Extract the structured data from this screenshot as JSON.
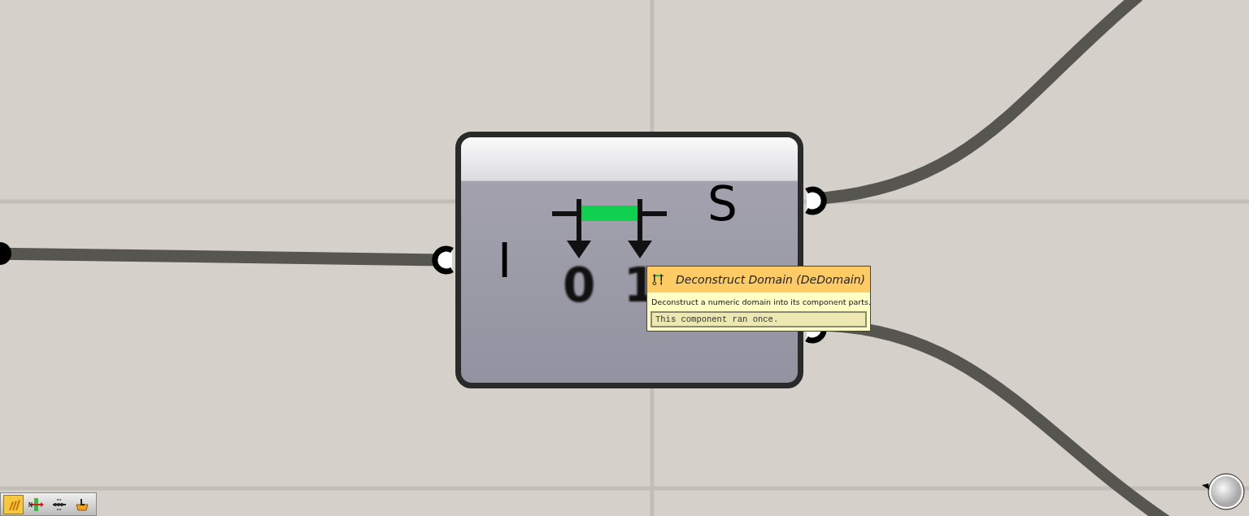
{
  "component": {
    "inputs": [
      {
        "label": "I"
      }
    ],
    "outputs": [
      {
        "label": "S"
      },
      {
        "kind": "grip"
      }
    ],
    "icon_digits": [
      "0",
      "1"
    ]
  },
  "tooltip": {
    "title": "Deconstruct Domain (DeDomain)",
    "description": "Deconstruct a numeric domain into its component parts.",
    "status": "This component ran once."
  },
  "toolbar": {
    "buttons": [
      {
        "kind": "bars",
        "selected": true
      },
      {
        "kind": "slider",
        "selected": false
      },
      {
        "kind": "dots",
        "selected": false
      },
      {
        "kind": "box",
        "selected": false
      }
    ]
  }
}
